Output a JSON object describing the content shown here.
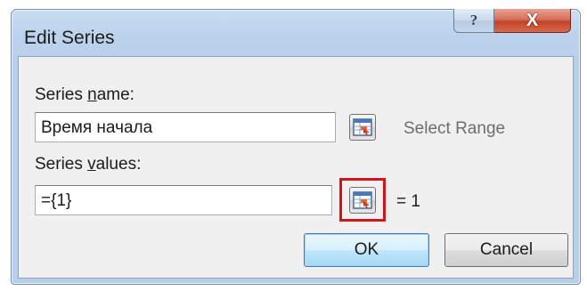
{
  "dialog": {
    "title": "Edit Series",
    "help_label": "?",
    "close_label": "X"
  },
  "series_name": {
    "label_prefix": "Series ",
    "label_accel": "n",
    "label_suffix": "ame:",
    "value": "Время начала",
    "range_preview": "Select Range",
    "range_icon": "range-select-icon"
  },
  "series_values": {
    "label_prefix": "Series ",
    "label_accel": "v",
    "label_suffix": "alues:",
    "value": "={1}",
    "range_preview": "= 1",
    "range_icon": "range-select-icon",
    "highlight_color": "#d4141b"
  },
  "buttons": {
    "ok_label": "OK",
    "cancel_label": "Cancel"
  }
}
